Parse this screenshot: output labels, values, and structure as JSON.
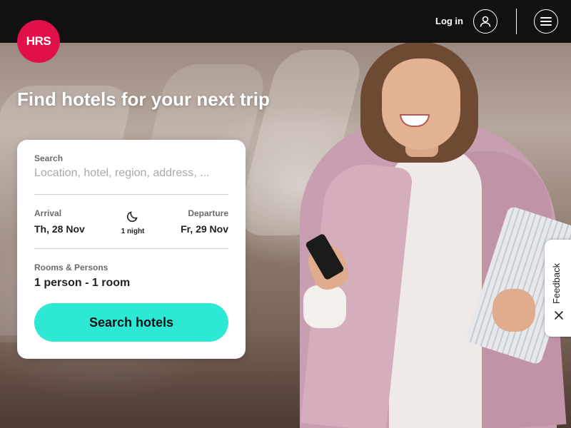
{
  "brand": {
    "logo_text": "HRS",
    "logo_color": "#e0114a"
  },
  "header": {
    "login_label": "Log in",
    "user_icon": "user-icon",
    "menu_icon": "hamburger-menu-icon"
  },
  "hero": {
    "headline": "Find hotels for your next trip"
  },
  "search_card": {
    "search_label": "Search",
    "search_placeholder": "Location, hotel, region, address, ...",
    "search_value": "",
    "arrival_label": "Arrival",
    "arrival_value": "Th, 28 Nov",
    "nights_icon": "moon-icon",
    "nights_text": "1 night",
    "departure_label": "Departure",
    "departure_value": "Fr, 29 Nov",
    "rooms_label": "Rooms & Persons",
    "rooms_value": "1 person - 1 room",
    "search_button_label": "Search hotels",
    "button_color": "#2ee8d6"
  },
  "feedback_tab": {
    "label": "Feedback",
    "close_icon": "close-icon"
  }
}
